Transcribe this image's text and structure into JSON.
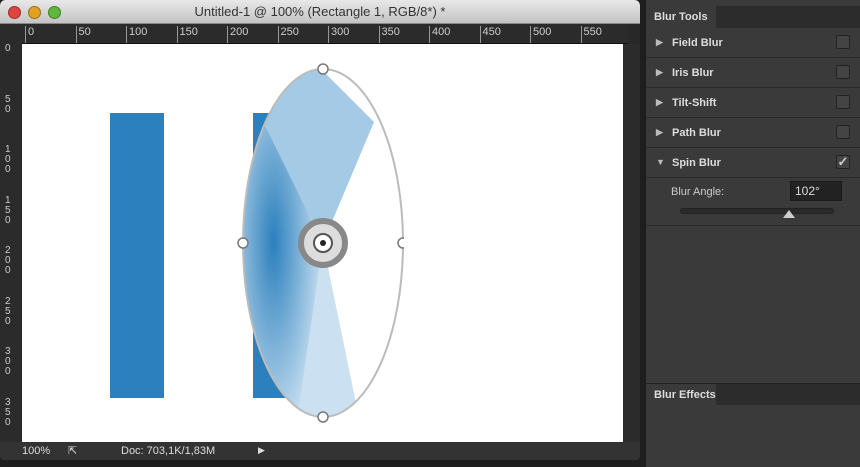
{
  "window": {
    "title": "Untitled-1 @ 100% (Rectangle 1, RGB/8*) *"
  },
  "ruler_h": [
    "0",
    "50",
    "100",
    "150",
    "200",
    "250",
    "300",
    "350",
    "400",
    "450",
    "500",
    "550"
  ],
  "ruler_v": [
    "0",
    "50",
    "100",
    "150",
    "200",
    "250",
    "300",
    "350"
  ],
  "status": {
    "zoom": "100%",
    "doc": "Doc: 703,1K/1,83M"
  },
  "panel": {
    "tab": "Blur Tools",
    "items": [
      {
        "label": "Field Blur",
        "checked": false
      },
      {
        "label": "Iris Blur",
        "checked": false
      },
      {
        "label": "Tilt-Shift",
        "checked": false
      },
      {
        "label": "Path Blur",
        "checked": false
      },
      {
        "label": "Spin Blur",
        "checked": true
      }
    ],
    "spin": {
      "angle_label": "Blur Angle:",
      "angle_value": "102°",
      "slider_fraction": 0.71
    },
    "effects_tab": "Blur Effects"
  },
  "colors": {
    "rect": "#2b80bd"
  }
}
